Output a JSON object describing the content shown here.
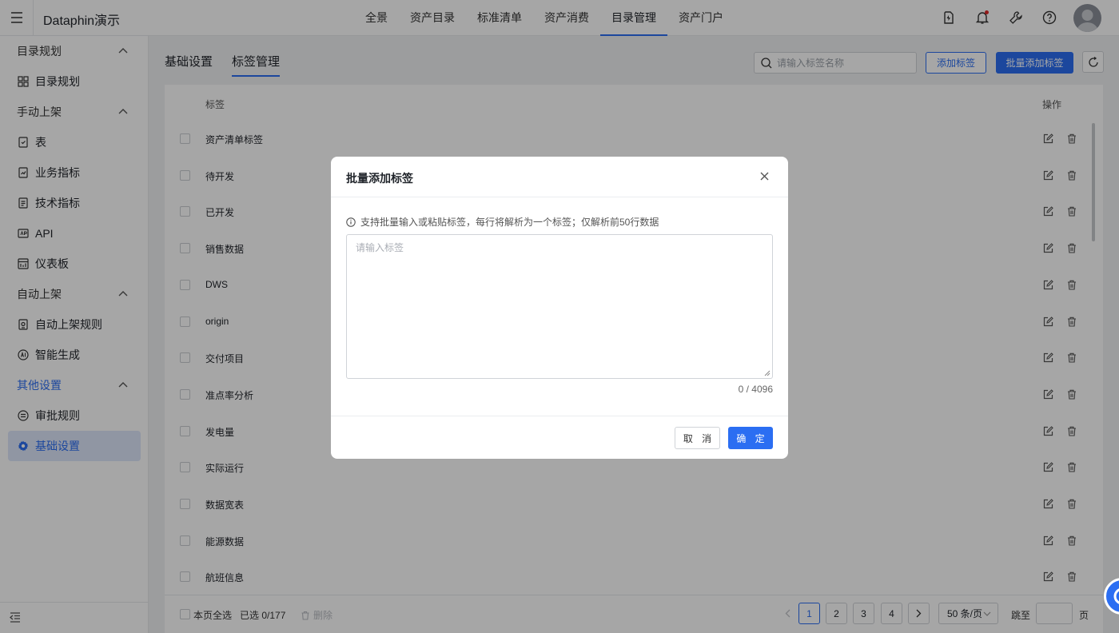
{
  "app": {
    "title": "Dataphin演示"
  },
  "nav": [
    {
      "label": "全景"
    },
    {
      "label": "资产目录"
    },
    {
      "label": "标准清单"
    },
    {
      "label": "资产消费"
    },
    {
      "label": "目录管理"
    },
    {
      "label": "资产门户"
    }
  ],
  "sidebar": {
    "groups": [
      {
        "label": "目录规划"
      },
      {
        "label": "手动上架"
      },
      {
        "label": "自动上架"
      },
      {
        "label": "其他设置"
      }
    ],
    "items": [
      {
        "label": "目录规划"
      },
      {
        "label": "表"
      },
      {
        "label": "业务指标"
      },
      {
        "label": "技术指标"
      },
      {
        "label": "API"
      },
      {
        "label": "仪表板"
      },
      {
        "label": "自动上架规则"
      },
      {
        "label": "智能生成"
      },
      {
        "label": "审批规则"
      },
      {
        "label": "基础设置"
      }
    ]
  },
  "tabs": [
    {
      "label": "基础设置"
    },
    {
      "label": "标签管理"
    }
  ],
  "toolbar": {
    "search_placeholder": "请输入标签名称",
    "add_label": "添加标签",
    "batch_add_label": "批量添加标签"
  },
  "table": {
    "columns": {
      "tag": "标签",
      "actions": "操作"
    },
    "rows": [
      "资产清单标签",
      "待开发",
      "已开发",
      "销售数据",
      "DWS",
      "origin",
      "交付项目",
      "准点率分析",
      "发电量",
      "实际运行",
      "数据宽表",
      "能源数据",
      "航班信息"
    ]
  },
  "footer": {
    "select_all": "本页全选",
    "selected": "已选 0/177",
    "delete": "删除",
    "pages": [
      "1",
      "2",
      "3",
      "4"
    ],
    "current_page": "1",
    "page_size": "50 条/页",
    "jump_to": "跳至",
    "page_unit": "页"
  },
  "modal": {
    "title": "批量添加标签",
    "tip": "支持批量输入或粘贴标签，每行将解析为一个标签；仅解析前50行数据",
    "placeholder": "请输入标签",
    "counter": "0 / 4096",
    "cancel": "取 消",
    "ok": "确 定"
  },
  "colors": {
    "accent": "#2b6ef2",
    "notification_dot": "#e02828"
  }
}
